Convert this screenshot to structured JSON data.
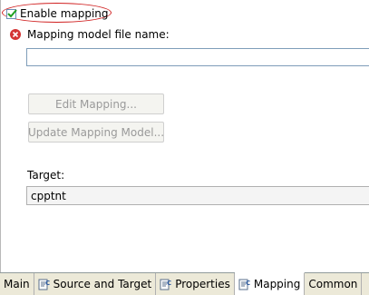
{
  "mapping": {
    "enable_mapping_label": "Enable mapping",
    "enable_mapping_checked": true,
    "model_file_label": "Mapping model file name:",
    "model_file_value": "",
    "edit_button_label": "Edit Mapping...",
    "update_button_label": "Update Mapping Model...",
    "target_label": "Target:",
    "target_value": "cpptnt"
  },
  "tabs": [
    {
      "label": "Main",
      "icon": null,
      "active": false
    },
    {
      "label": "Source and Target",
      "icon": "launch-config-icon",
      "active": false
    },
    {
      "label": "Properties",
      "icon": "launch-config-icon",
      "active": false
    },
    {
      "label": "Mapping",
      "icon": "launch-config-icon",
      "active": true
    },
    {
      "label": "Common",
      "icon": null,
      "active": false
    }
  ],
  "colors": {
    "highlight_ellipse": "#d02020",
    "error_icon": "#d43434"
  }
}
